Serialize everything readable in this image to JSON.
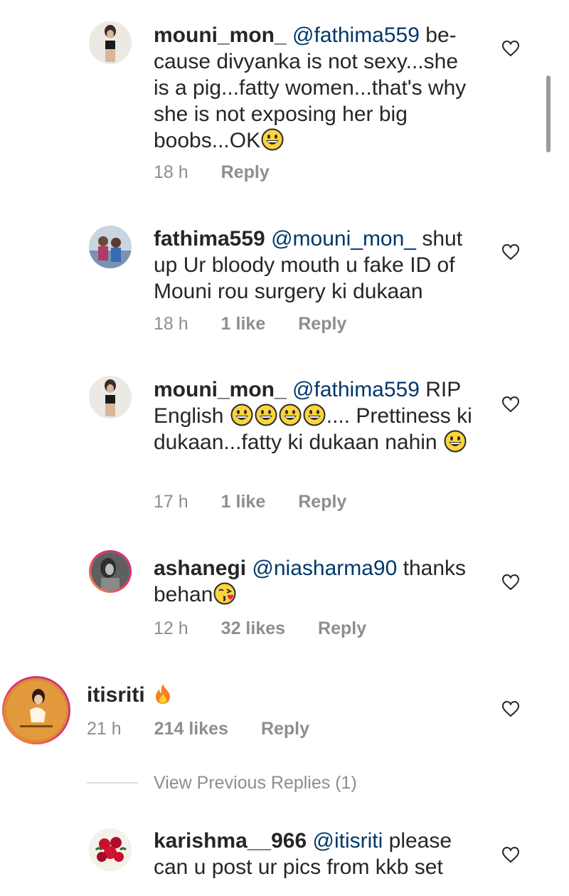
{
  "comments": [
    {
      "username": "mouni_mon_",
      "mention": "@fathima559",
      "text1": " be-cause divyanka is not sexy...she is a pig...fatty women...that's why she is not exposing her big boobs...OK",
      "time": "18 h",
      "likes": "",
      "reply": "Reply"
    },
    {
      "username": "fathima559",
      "mention": "@mouni_mon_",
      "text1": " shut up Ur bloody mouth u fake ID of Mouni rou surgery ki dukaan",
      "time": "18 h",
      "likes": "1 like",
      "reply": "Reply"
    },
    {
      "username": "mouni_mon_",
      "mention": "@fathima559",
      "text1": " RIP English ",
      "text2": ".... Prettiness ki dukaan...fatty ki dukaan nahin ",
      "time": "17 h",
      "likes": "1 like",
      "reply": "Reply"
    },
    {
      "username": "ashanegi",
      "mention": "@niasharma90",
      "text1": " thanks behan",
      "time": "12 h",
      "likes": "32 likes",
      "reply": "Reply"
    },
    {
      "username": "itisriti",
      "mention": "",
      "text1": " ",
      "time": "21 h",
      "likes": "214 likes",
      "reply": "Reply"
    },
    {
      "username": "karishma__966",
      "mention": "@itisriti",
      "text1": " please can u post ur pics from kkb set",
      "time": "",
      "likes": "",
      "reply": ""
    }
  ],
  "view_previous": "View Previous Replies (1)",
  "icons": {
    "heart": "heart-outline-icon",
    "grin": "grinning-face-emoji",
    "kiss": "face-blowing-kiss-emoji",
    "fire": "fire-emoji"
  },
  "colors": {
    "mention": "#00376b",
    "meta": "#8e8e8e",
    "text": "#262626"
  }
}
